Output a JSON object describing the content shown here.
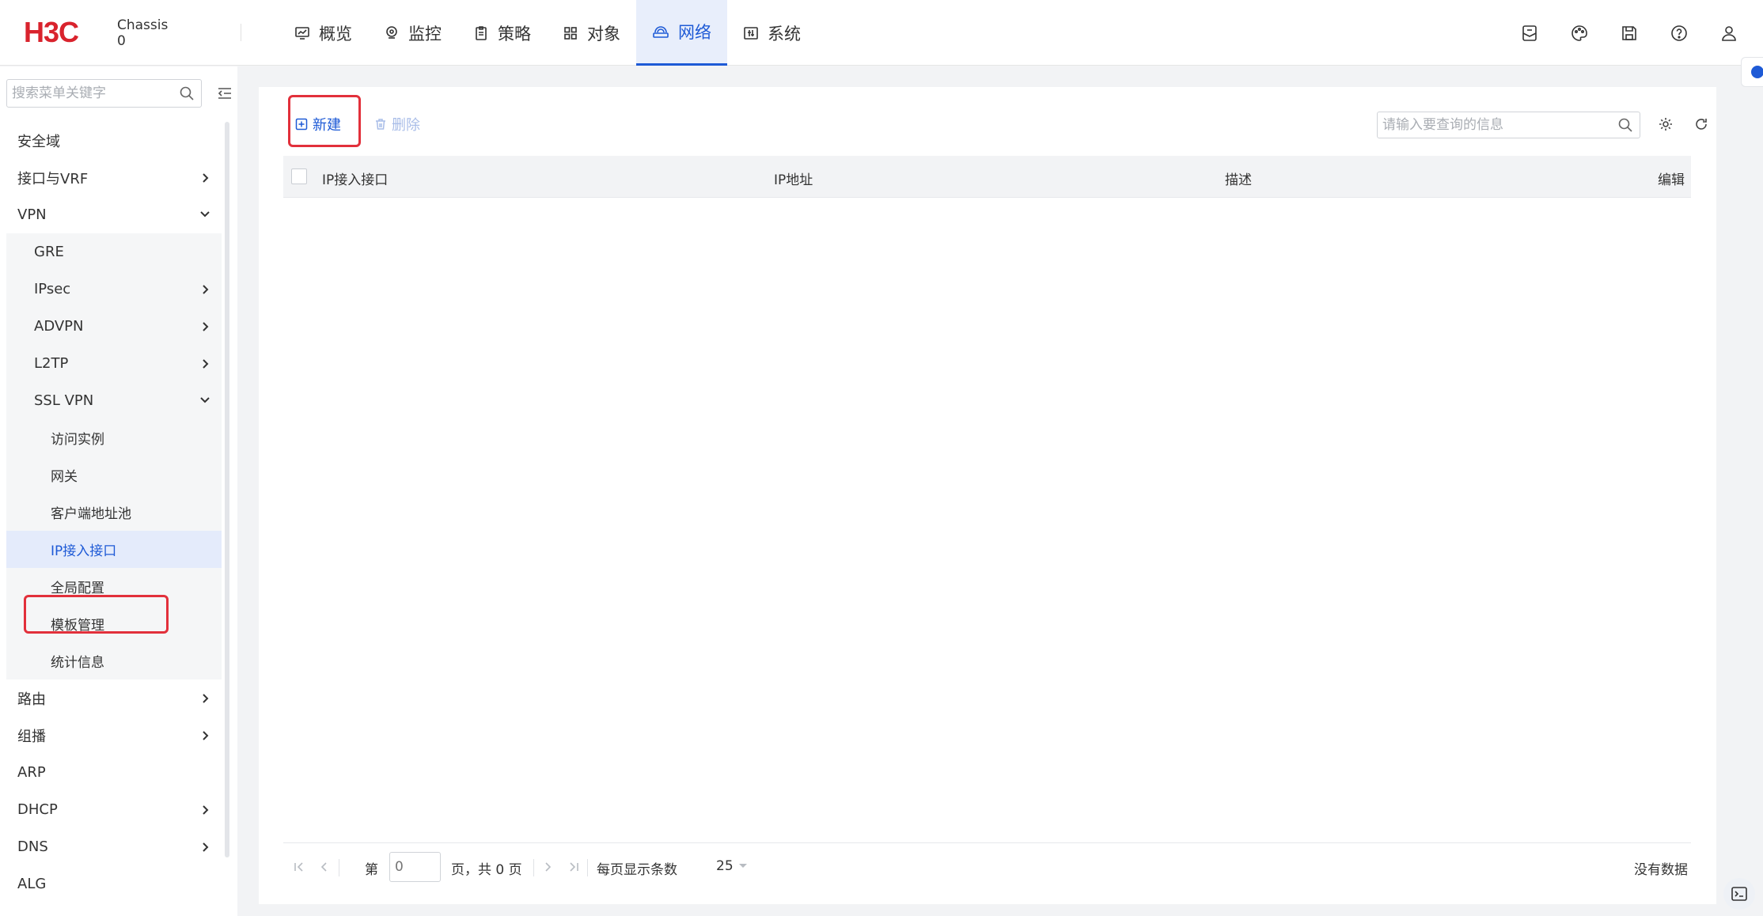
{
  "brand": {
    "logo_text": "H3C",
    "device_name": "Chassis",
    "device_id": "0"
  },
  "nav": [
    {
      "label": "概览",
      "icon": "monitor-icon"
    },
    {
      "label": "监控",
      "icon": "location-pin-icon"
    },
    {
      "label": "策略",
      "icon": "clipboard-icon"
    },
    {
      "label": "对象",
      "icon": "grid-icon"
    },
    {
      "label": "网络",
      "icon": "network-icon",
      "active": true
    },
    {
      "label": "系统",
      "icon": "system-icon"
    }
  ],
  "top_tools": [
    "mail-icon",
    "palette-icon",
    "save-icon",
    "help-icon",
    "user-icon"
  ],
  "sidebar": {
    "search_placeholder": "搜索菜单关键字",
    "items": [
      {
        "label": "安全域",
        "level": 1
      },
      {
        "label": "接口与VRF",
        "level": 1,
        "arrow": "right"
      },
      {
        "label": "VPN",
        "level": 1,
        "arrow": "down"
      },
      {
        "label": "GRE",
        "level": 2
      },
      {
        "label": "IPsec",
        "level": 2,
        "arrow": "right"
      },
      {
        "label": "ADVPN",
        "level": 2,
        "arrow": "right"
      },
      {
        "label": "L2TP",
        "level": 2,
        "arrow": "right"
      },
      {
        "label": "SSL VPN",
        "level": 2,
        "arrow": "down"
      },
      {
        "label": "访问实例",
        "level": 3
      },
      {
        "label": "网关",
        "level": 3
      },
      {
        "label": "客户端地址池",
        "level": 3
      },
      {
        "label": "IP接入接口",
        "level": 3,
        "active": true
      },
      {
        "label": "全局配置",
        "level": 3
      },
      {
        "label": "模板管理",
        "level": 3
      },
      {
        "label": "统计信息",
        "level": 3
      },
      {
        "label": "路由",
        "level": 1,
        "arrow": "right"
      },
      {
        "label": "组播",
        "level": 1,
        "arrow": "right"
      },
      {
        "label": "ARP",
        "level": 1
      },
      {
        "label": "DHCP",
        "level": 1,
        "arrow": "right"
      },
      {
        "label": "DNS",
        "level": 1,
        "arrow": "right"
      },
      {
        "label": "ALG",
        "level": 1
      }
    ]
  },
  "toolbar": {
    "new_label": "新建",
    "delete_label": "删除",
    "query_placeholder": "请输入要查询的信息"
  },
  "table": {
    "columns": [
      "IP接入接口",
      "IP地址",
      "描述",
      "编辑"
    ],
    "rows": []
  },
  "pager": {
    "page_prefix": "第",
    "page_value": "0",
    "page_suffix": "页，共 0 页",
    "page_size_label": "每页显示条数",
    "page_size": "25",
    "no_data": "没有数据"
  },
  "colors": {
    "accent": "#1e5ad6",
    "highlight_box": "#e2303b",
    "active_bg": "#e4ebfb"
  }
}
